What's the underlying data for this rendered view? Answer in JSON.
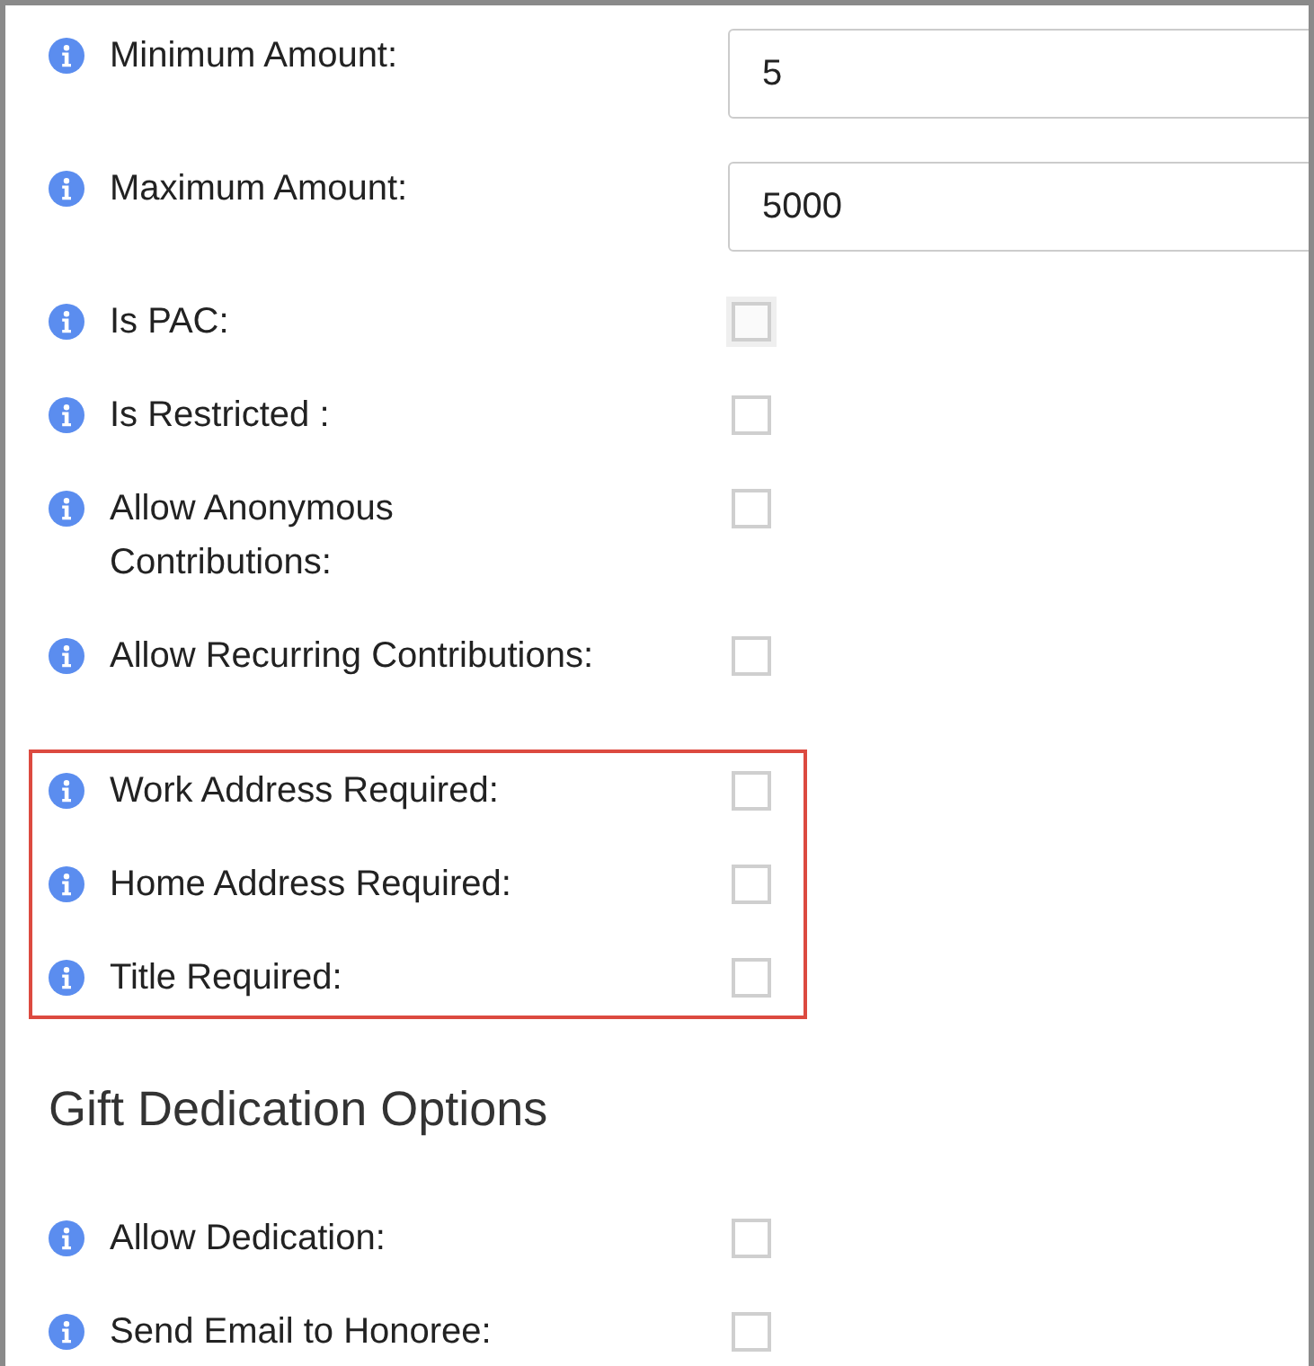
{
  "groups": [
    {
      "fields": [
        {
          "kind": "input",
          "label": "Minimum Amount:",
          "value": "5"
        },
        {
          "kind": "input",
          "label": "Maximum Amount:",
          "value": "5000"
        },
        {
          "kind": "checkbox",
          "label": "Is PAC:",
          "checked": false,
          "focused": true
        },
        {
          "kind": "checkbox",
          "label": "Is Restricted :",
          "checked": false
        },
        {
          "kind": "checkbox",
          "label": "Allow Anonymous Contributions:",
          "checked": false
        },
        {
          "kind": "checkbox",
          "label": "Allow Recurring Contributions:",
          "checked": false
        }
      ]
    },
    {
      "outlined": true,
      "fields": [
        {
          "kind": "checkbox",
          "label": "Work Address Required:",
          "checked": false
        },
        {
          "kind": "checkbox",
          "label": "Home Address Required:",
          "checked": false
        },
        {
          "kind": "checkbox",
          "label": "Title Required:",
          "checked": false
        }
      ]
    },
    {
      "heading": "Gift Dedication Options",
      "fields": [
        {
          "kind": "checkbox",
          "label": "Allow Dedication:",
          "checked": false
        },
        {
          "kind": "checkbox",
          "label": "Send Email to Honoree:",
          "checked": false
        }
      ]
    }
  ]
}
